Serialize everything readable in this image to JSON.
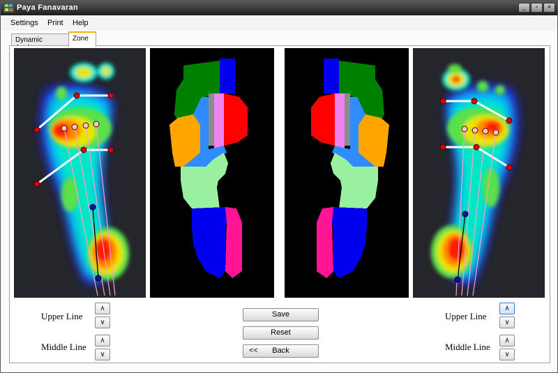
{
  "window": {
    "title": "Paya Fanavaran",
    "controls": {
      "minimize": "_",
      "restore": "▫",
      "close": "×"
    }
  },
  "menu": [
    "Settings",
    "Print",
    "Help"
  ],
  "tabs": [
    {
      "label": "Dynamic Analyze",
      "active": false
    },
    {
      "label": "Zone",
      "active": true
    }
  ],
  "controls": {
    "left": {
      "upper_label": "Upper  Line",
      "middle_label": "Middle Line"
    },
    "right": {
      "upper_label": "Upper  Line",
      "middle_label": "Middle Line"
    },
    "up_glyph": "∧",
    "down_glyph": "∨",
    "save": "Save",
    "reset": "Reset",
    "back": "Back",
    "back_arrows": "<<"
  },
  "zone_colors": {
    "green": "#008000",
    "blue": "#0000ee",
    "red": "#ff0000",
    "pink": "#ee82ee",
    "gray": "#8c8c8c",
    "light_blue": "#2e8cff",
    "orange": "#ffa500",
    "light_green": "#98f0a0",
    "magenta": "#ff1493"
  },
  "heatmap_colors": [
    "#1e2ad6",
    "#00b4ff",
    "#00e6c8",
    "#5ce04a",
    "#e6e600",
    "#ff8c00",
    "#ff1a00"
  ]
}
